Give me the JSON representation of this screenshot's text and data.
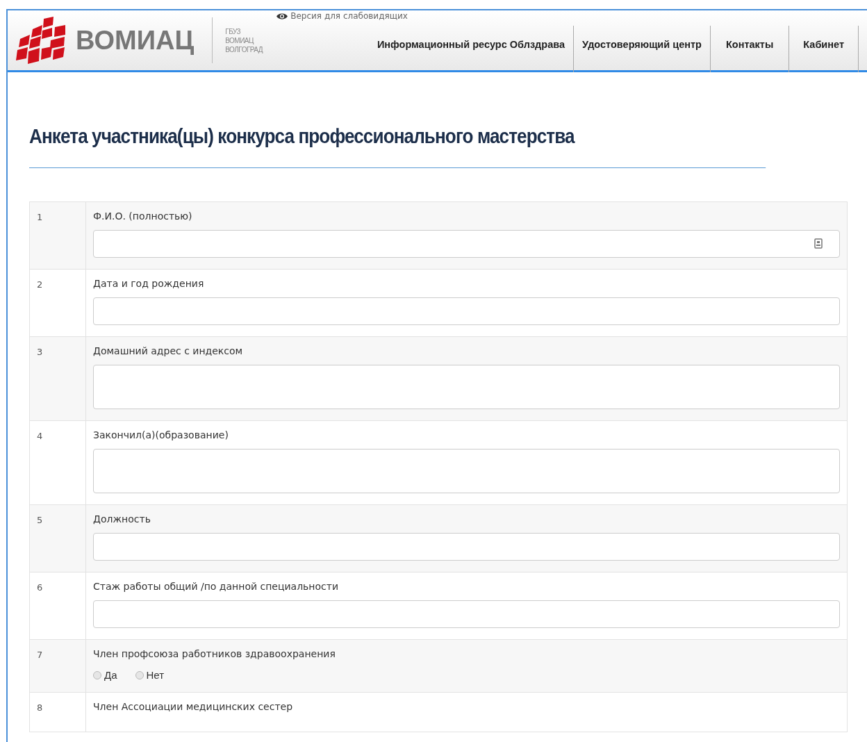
{
  "header": {
    "logo_text": "ВОМИАЦ",
    "org_lines": [
      "ГБУЗ",
      "ВОМИАЦ",
      "ВОЛГОГРАД"
    ],
    "accessibility_link": "Версия для слабовидящих",
    "nav": [
      "Информационный ресурс Облздрава",
      "Удостоверяющий центр",
      "Контакты",
      "Кабинет"
    ]
  },
  "page_title": "Анкета участника(цы) конкурса профессионального мастерства",
  "form_rows": [
    {
      "number": "1",
      "label": "Ф.И.О. (полностью)",
      "kind": "text",
      "field_icon": true
    },
    {
      "number": "2",
      "label": "Дата и год рождения",
      "kind": "text",
      "field_icon": false
    },
    {
      "number": "3",
      "label": "Домашний адрес с индексом",
      "kind": "textarea",
      "field_icon": false
    },
    {
      "number": "4",
      "label": "Закончил(а)(образование)",
      "kind": "textarea",
      "field_icon": false
    },
    {
      "number": "5",
      "label": "Должность",
      "kind": "text",
      "field_icon": false
    },
    {
      "number": "6",
      "label": "Стаж работы общий /по данной специальности",
      "kind": "text",
      "field_icon": false
    },
    {
      "number": "7",
      "label": "Член профсоюза работников здравоохранения",
      "kind": "radio",
      "options": [
        {
          "label": "Да",
          "selected": false
        },
        {
          "label": "Нет",
          "selected": false
        }
      ]
    },
    {
      "number": "8",
      "label": "Член Ассоциации медицинских сестер",
      "kind": "none"
    }
  ]
}
